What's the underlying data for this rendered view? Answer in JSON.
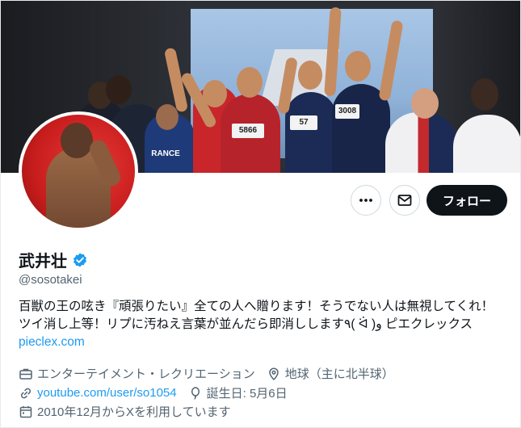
{
  "profile": {
    "name": "武井壮",
    "handle": "@sosotakei",
    "verified": true,
    "verified_color": "#1d9bf0"
  },
  "actions": {
    "more_icon": "more-horizontal-icon",
    "message_icon": "envelope-icon",
    "follow_label": "フォロー"
  },
  "bio": {
    "text": "百獣の王の呟き『頑張りたい』全ての人へ贈ります！そうでない人は無視してくれ！ツイ消し上等！リプに汚ねえ言葉が並んだら即消しします٩( ᐛ )و ピエクレックス",
    "link": "pieclex.com"
  },
  "meta": {
    "category": "エンターテイメント・レクリエーション",
    "location": "地球（主に北半球）",
    "url": "youtube.com/user/so1054",
    "birthday": "誕生日: 5月6日",
    "joined": "2010年12月からXを利用しています"
  },
  "banner": {
    "bibs": [
      "5866",
      "57",
      "3008"
    ],
    "shirt_text": "RANCE"
  },
  "colors": {
    "accent": "#1d9bf0",
    "text_primary": "#0f1419",
    "text_secondary": "#536471",
    "follow_bg": "#0f1419"
  }
}
